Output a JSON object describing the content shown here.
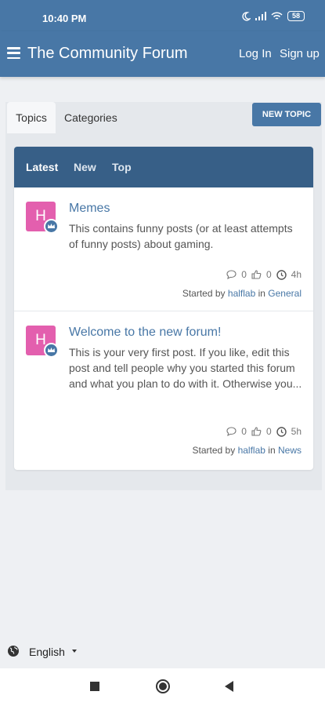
{
  "status_bar": {
    "time": "10:40 PM",
    "battery": "58"
  },
  "header": {
    "title": "The Community Forum",
    "login": "Log In",
    "signup": "Sign up"
  },
  "tabs": {
    "topics": "Topics",
    "categories": "Categories"
  },
  "new_topic": "NEW TOPIC",
  "subnav": {
    "latest": "Latest",
    "new": "New",
    "top": "Top"
  },
  "topics": [
    {
      "avatar_letter": "H",
      "title": "Memes",
      "excerpt": "This contains funny posts (or at least attempts of funny posts) about gaming.",
      "replies": "0",
      "likes": "0",
      "age": "4h",
      "started_by": "Started by",
      "author": "halflab",
      "in": "in",
      "category": "General"
    },
    {
      "avatar_letter": "H",
      "title": "Welcome to the new forum!",
      "excerpt": "This is your very first post. If you like, edit this post and tell people why you started this forum and what you plan to do with it. Otherwise you...",
      "replies": "0",
      "likes": "0",
      "age": "5h",
      "started_by": "Started by",
      "author": "halflab",
      "in": "in",
      "category": "News"
    }
  ],
  "language": "English",
  "colors": {
    "primary": "#4877a6",
    "subnav": "#375f87",
    "avatar": "#e35fae"
  }
}
